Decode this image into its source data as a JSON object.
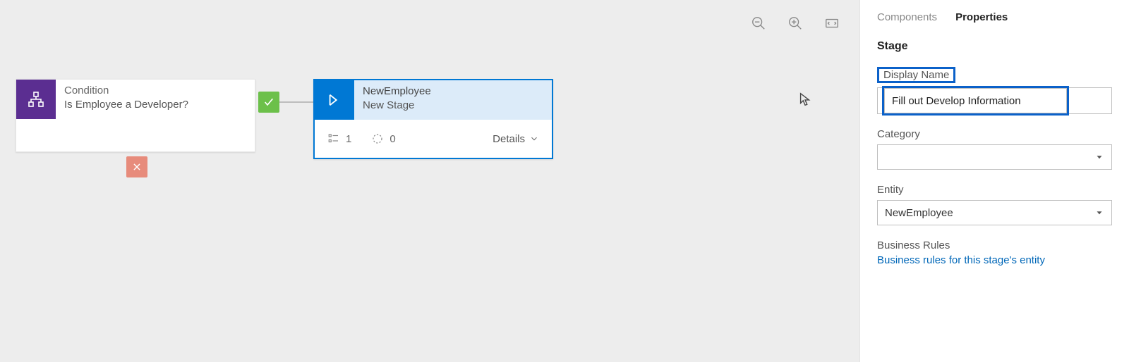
{
  "toolbar": {
    "zoom_out": "zoom-out",
    "zoom_in": "zoom-in",
    "fit": "fit-screen"
  },
  "condition": {
    "type_label": "Condition",
    "name": "Is Employee a Developer?"
  },
  "stage": {
    "entity": "NewEmployee",
    "name": "New Stage",
    "steps_count": "1",
    "processes_count": "0",
    "details_label": "Details"
  },
  "panel": {
    "tabs": {
      "components": "Components",
      "properties": "Properties"
    },
    "section_title": "Stage",
    "display_name_label": "Display Name",
    "display_name_value": "Fill out Develop Information",
    "category_label": "Category",
    "category_value": "",
    "entity_label": "Entity",
    "entity_value": "NewEmployee",
    "business_rules_label": "Business Rules",
    "business_rules_link": "Business rules for this stage's entity"
  }
}
